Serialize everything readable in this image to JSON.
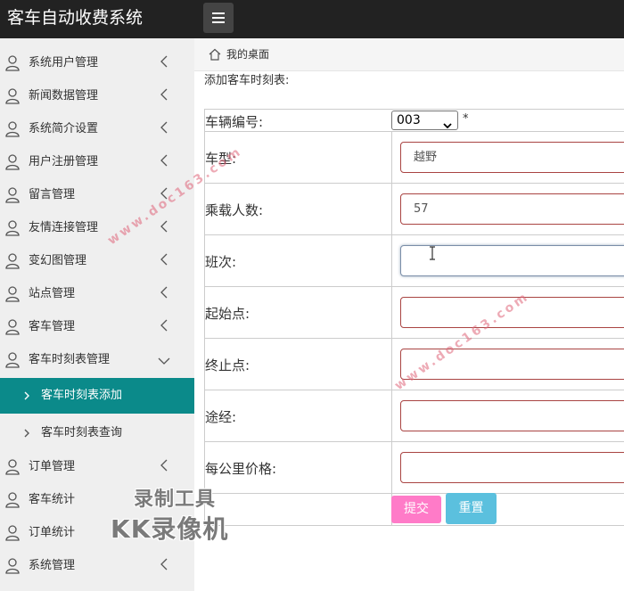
{
  "header": {
    "app_title": "客车自动收费系统",
    "menu_icon": "hamburger-menu-icon"
  },
  "sidebar": {
    "items": [
      {
        "label": "系统用户管理",
        "icon": "user-icon",
        "chevron": "left"
      },
      {
        "label": "新闻数据管理",
        "icon": "user-icon",
        "chevron": "left"
      },
      {
        "label": "系统简介设置",
        "icon": "user-icon",
        "chevron": "left"
      },
      {
        "label": "用户注册管理",
        "icon": "user-icon",
        "chevron": "left"
      },
      {
        "label": "留言管理",
        "icon": "user-icon",
        "chevron": "left"
      },
      {
        "label": "友情连接管理",
        "icon": "user-icon",
        "chevron": "left"
      },
      {
        "label": "变幻图管理",
        "icon": "user-icon",
        "chevron": "left"
      },
      {
        "label": "站点管理",
        "icon": "user-icon",
        "chevron": "left"
      },
      {
        "label": "客车管理",
        "icon": "user-icon",
        "chevron": "left"
      },
      {
        "label": "客车时刻表管理",
        "icon": "user-icon",
        "chevron": "down"
      }
    ],
    "sub_items": [
      {
        "label": "客车时刻表添加",
        "active": true
      },
      {
        "label": "客车时刻表查询",
        "active": false
      }
    ],
    "items_after": [
      {
        "label": "订单管理",
        "icon": "user-icon",
        "chevron": "left"
      },
      {
        "label": "客车统计",
        "icon": "user-icon",
        "chevron": "left"
      },
      {
        "label": "订单统计",
        "icon": "user-icon",
        "chevron": "left"
      },
      {
        "label": "系统管理",
        "icon": "user-icon",
        "chevron": "left"
      }
    ],
    "active_color": "#0b8a8a"
  },
  "breadcrumb": {
    "text": "我的桌面",
    "icon": "home-icon"
  },
  "form": {
    "title": "添加客车时刻表:",
    "vehicle": {
      "label": "车辆编号:",
      "selected": "003",
      "required_mark": "*"
    },
    "fields": [
      {
        "label": "车型:",
        "value": "越野"
      },
      {
        "label": "乘载人数:",
        "value": "57"
      },
      {
        "label": "班次:",
        "value": ""
      },
      {
        "label": "起始点:",
        "value": ""
      },
      {
        "label": "终止点:",
        "value": ""
      },
      {
        "label": "途经:",
        "value": ""
      },
      {
        "label": "每公里价格:",
        "value": ""
      }
    ],
    "submit_label": "提交",
    "reset_label": "重置",
    "submit_color": "#ff7bc8",
    "reset_color": "#5bc0de"
  },
  "watermarks": {
    "site": "www.doc163.com",
    "recorder_line1": "录制工具",
    "recorder_line2": "KK录像机"
  }
}
